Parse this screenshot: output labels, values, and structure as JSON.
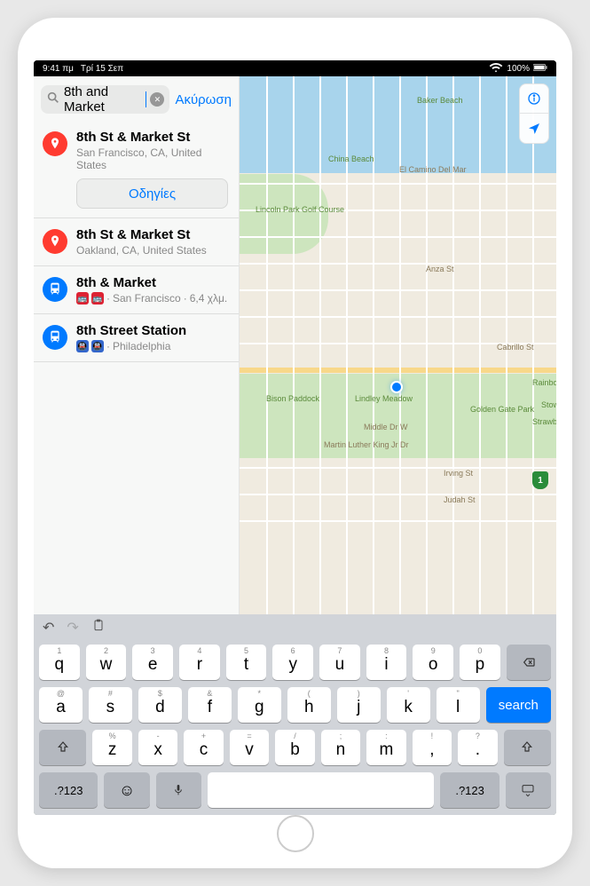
{
  "status": {
    "time": "9:41 πμ",
    "date": "Τρί 15 Σεπ",
    "battery": "100%"
  },
  "search": {
    "query": "8th and Market",
    "cancel_label": "Ακύρωση"
  },
  "results": [
    {
      "icon": "pin",
      "title": "8th St & Market St",
      "subtitle": "San Francisco, CA, United States",
      "directions_label": "Οδηγίες"
    },
    {
      "icon": "pin",
      "title": "8th St & Market St",
      "subtitle": "Oakland, CA, United States"
    },
    {
      "icon": "transit",
      "title": "8th & Market",
      "badges": [
        "red",
        "red"
      ],
      "subtitle_parts": [
        "San Francisco",
        "6,4 χλμ."
      ]
    },
    {
      "icon": "transit",
      "title": "8th Street Station",
      "badges": [
        "blue",
        "blue"
      ],
      "subtitle_parts": [
        "Philadelphia"
      ]
    }
  ],
  "map_labels": {
    "baker_beach": "Baker Beach",
    "china_beach": "China Beach",
    "el_camino": "El Camino Del Mar",
    "lincoln_park": "Lincoln Park Golf Course",
    "bison": "Bison Paddock",
    "lindley": "Lindley Meadow",
    "gg_park": "Golden Gate Park",
    "mlk": "Martin Luther King Jr Dr",
    "irving": "Irving St",
    "judah": "Judah St",
    "cabrillo": "Cabrillo St",
    "anza": "Anza St",
    "middle_dr": "Middle Dr W",
    "rainbow": "Rainbow Falls",
    "strawberry": "Strawberry Hill",
    "stow": "Stow Lake",
    "route": "1"
  },
  "keyboard": {
    "row1": [
      {
        "alt": "1",
        "main": "q"
      },
      {
        "alt": "2",
        "main": "w"
      },
      {
        "alt": "3",
        "main": "e"
      },
      {
        "alt": "4",
        "main": "r"
      },
      {
        "alt": "5",
        "main": "t"
      },
      {
        "alt": "6",
        "main": "y"
      },
      {
        "alt": "7",
        "main": "u"
      },
      {
        "alt": "8",
        "main": "i"
      },
      {
        "alt": "9",
        "main": "o"
      },
      {
        "alt": "0",
        "main": "p"
      }
    ],
    "row2": [
      {
        "alt": "@",
        "main": "a"
      },
      {
        "alt": "#",
        "main": "s"
      },
      {
        "alt": "$",
        "main": "d"
      },
      {
        "alt": "&",
        "main": "f"
      },
      {
        "alt": "*",
        "main": "g"
      },
      {
        "alt": "(",
        "main": "h"
      },
      {
        "alt": ")",
        "main": "j"
      },
      {
        "alt": "'",
        "main": "k"
      },
      {
        "alt": "\"",
        "main": "l"
      }
    ],
    "row3": [
      {
        "alt": "%",
        "main": "z"
      },
      {
        "alt": "-",
        "main": "x"
      },
      {
        "alt": "+",
        "main": "c"
      },
      {
        "alt": "=",
        "main": "v"
      },
      {
        "alt": "/",
        "main": "b"
      },
      {
        "alt": ";",
        "main": "n"
      },
      {
        "alt": ":",
        "main": "m"
      },
      {
        "alt": "!",
        "main": ","
      },
      {
        "alt": "?",
        "main": "."
      }
    ],
    "numeric_label": ".?123",
    "search_label": "search"
  }
}
